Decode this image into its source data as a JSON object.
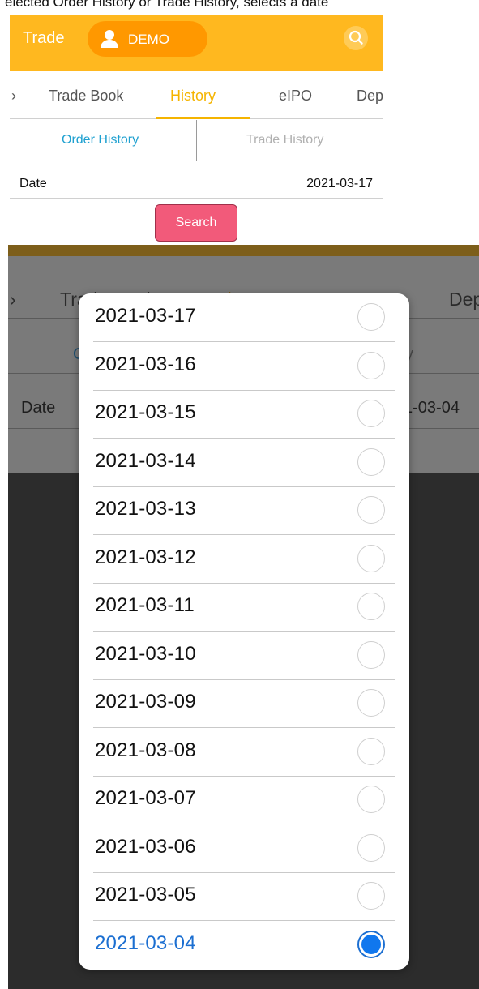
{
  "caption": "elected Order History or Trade History, selects a date",
  "top": {
    "app_title": "Trade",
    "demo_label": "DEMO",
    "tabs": [
      {
        "label": "›"
      },
      {
        "label": "Trade Book"
      },
      {
        "label": "History"
      },
      {
        "label": "eIPO"
      },
      {
        "label": "Dep"
      }
    ],
    "subtabs": {
      "order": "Order History",
      "trade": "Trade History"
    },
    "date_label": "Date",
    "date_value": "2021-03-17",
    "search_label": "Search"
  },
  "bottom": {
    "tabs": [
      {
        "label": "›"
      },
      {
        "label": "Trade Book"
      },
      {
        "label": "History"
      },
      {
        "label": "eIPO"
      },
      {
        "label": "Dep"
      }
    ],
    "sub_left": "O",
    "sub_right": "y",
    "date_label": "Date",
    "date_value_partial": "1-03-04"
  },
  "dialog": {
    "options": [
      {
        "label": "2021-03-17",
        "selected": false
      },
      {
        "label": "2021-03-16",
        "selected": false
      },
      {
        "label": "2021-03-15",
        "selected": false
      },
      {
        "label": "2021-03-14",
        "selected": false
      },
      {
        "label": "2021-03-13",
        "selected": false
      },
      {
        "label": "2021-03-12",
        "selected": false
      },
      {
        "label": "2021-03-11",
        "selected": false
      },
      {
        "label": "2021-03-10",
        "selected": false
      },
      {
        "label": "2021-03-09",
        "selected": false
      },
      {
        "label": "2021-03-08",
        "selected": false
      },
      {
        "label": "2021-03-07",
        "selected": false
      },
      {
        "label": "2021-03-06",
        "selected": false
      },
      {
        "label": "2021-03-05",
        "selected": false
      },
      {
        "label": "2021-03-04",
        "selected": true
      }
    ]
  },
  "colors": {
    "appbar": "#ffb81f",
    "accent_tab": "#f5b400",
    "demo_pill": "#ff9800",
    "search_button": "#f25a7a",
    "selected_radio": "#1077ee",
    "selected_text": "#1c6fd1",
    "order_history_text": "#1ea0d0"
  },
  "icons": {
    "user": "user-icon",
    "search": "search-icon",
    "radio": "radio-icon"
  }
}
